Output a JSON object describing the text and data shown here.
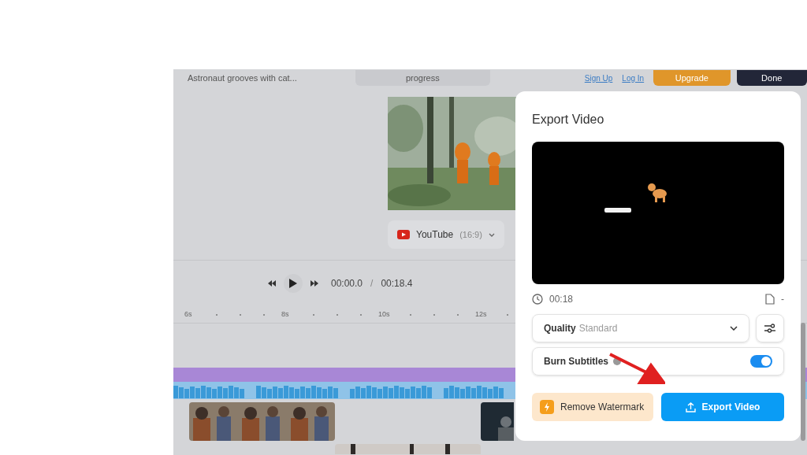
{
  "top_bar": {
    "project_title": "Astronaut grooves with cat...",
    "status": "progress",
    "links": [
      "Sign Up",
      "Log In"
    ],
    "upgrade_button": "Upgrade",
    "done_button": "Done"
  },
  "preview": {
    "aspect_dropdown": {
      "platform": "YouTube",
      "ratio": "(16:9)"
    }
  },
  "player": {
    "current_time": "00:00.0",
    "separator": "/",
    "total_time": "00:18.4"
  },
  "timeline": {
    "ticks": [
      "6s",
      "8s",
      "10s",
      "12s"
    ]
  },
  "export_dialog": {
    "title": "Export Video",
    "duration": "00:18",
    "file_size": "-",
    "quality": {
      "label": "Quality",
      "value": "Standard"
    },
    "burn_subtitles": {
      "label": "Burn Subtitles",
      "on": true
    },
    "remove_watermark_button": "Remove Watermark",
    "export_button": "Export Video"
  }
}
